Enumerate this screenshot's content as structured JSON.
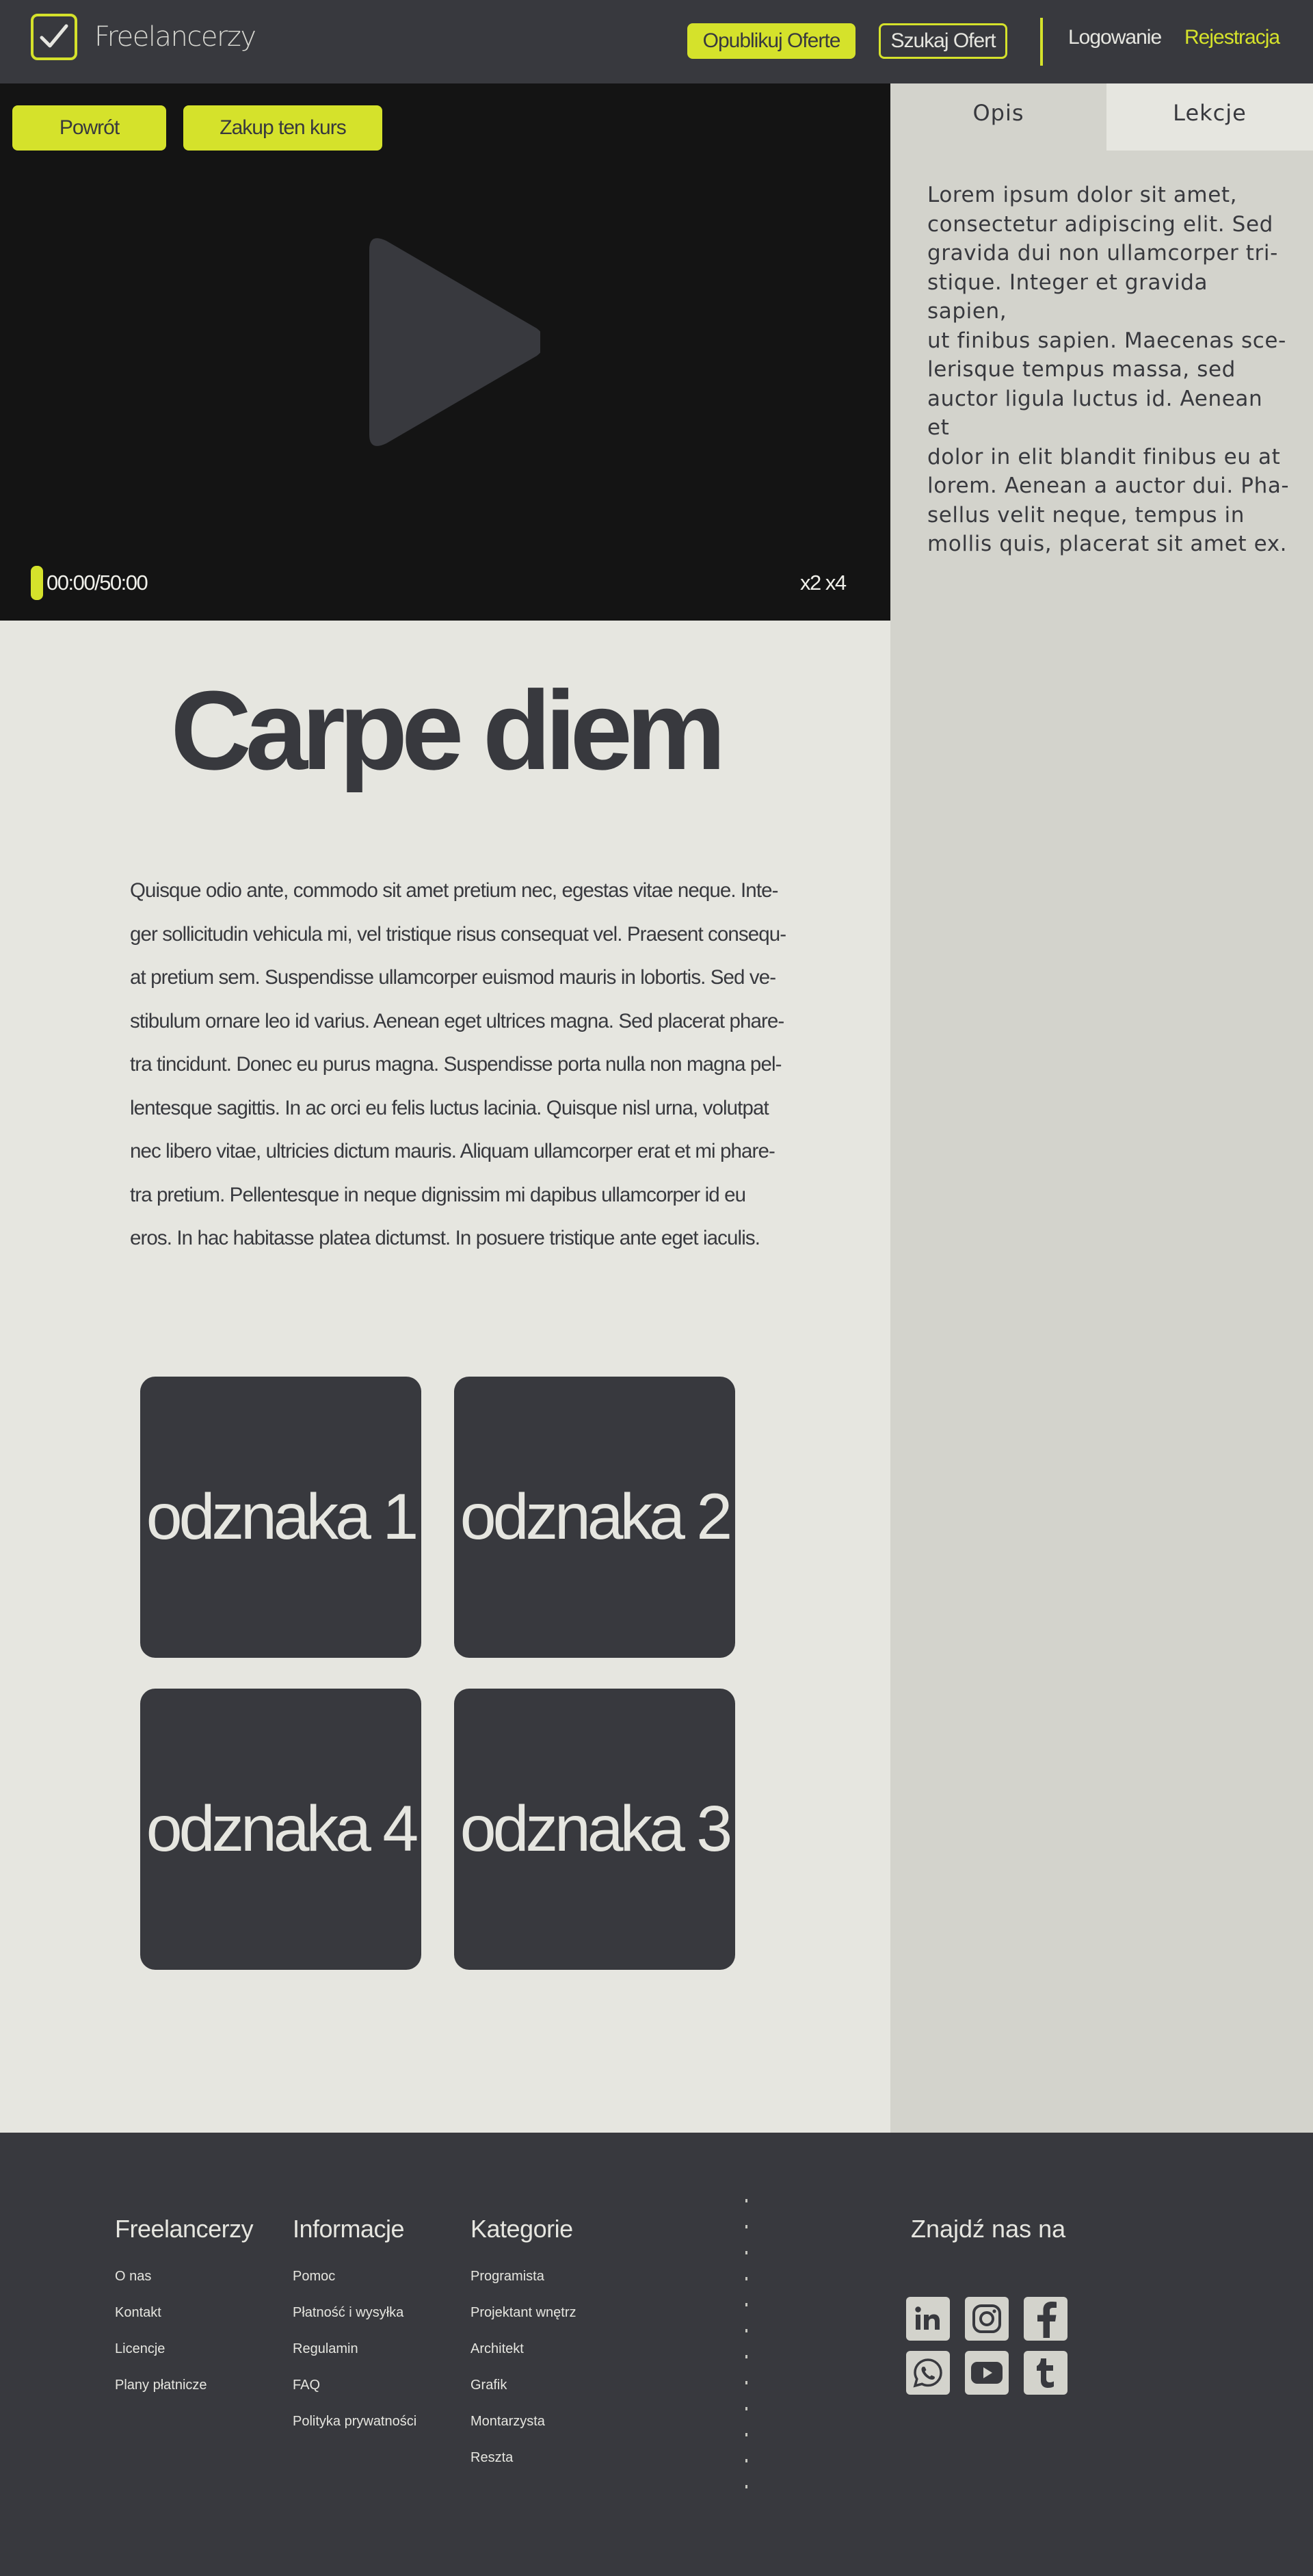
{
  "navbar": {
    "brand": "Freelancerzy",
    "publish_label": "Opublikuj Oferte",
    "search_label": "Szukaj Ofert",
    "login_label": "Logowanie",
    "register_label": "Rejestracja"
  },
  "video": {
    "back_label": "Powrót",
    "buy_label": "Zakup ten kurs",
    "time": "00:00/50:00",
    "speed": "x2 x4",
    "progress": 0
  },
  "sidebar": {
    "tabs": [
      {
        "label": "Opis",
        "active": true
      },
      {
        "label": "Lekcje",
        "active": false
      }
    ],
    "description": " Lorem ipsum dolor sit amet,\nconsectetur adipiscing elit. Sed\ngravida dui non ullamcorper tri-\nstique. Integer et gravida sapien,\nut finibus sapien. Maecenas sce-\nlerisque tempus massa, sed\nauctor ligula luctus id. Aenean et\ndolor in elit blandit finibus eu at\nlorem. Aenean a auctor dui. Pha-\nsellus velit neque, tempus in\nmollis quis, placerat sit amet ex."
  },
  "main": {
    "title": "Carpe diem",
    "body": "Quisque odio ante, commodo sit amet pretium nec, egestas vitae neque. Inte-\nger sollicitudin vehicula mi, vel tristique risus consequat vel. Praesent consequ-\nat pretium sem. Suspendisse ullamcorper euismod mauris in lobortis. Sed ve-\nstibulum ornare leo id varius. Aenean eget ultrices magna. Sed placerat phare-\ntra tincidunt. Donec eu purus magna. Suspendisse porta nulla non magna pel-\nlentesque sagittis. In ac orci eu felis luctus lacinia. Quisque nisl urna, volutpat\nnec libero vitae, ultricies dictum mauris. Aliquam ullamcorper erat et mi phare-\ntra pretium. Pellentesque in neque dignissim mi dapibus ullamcorper id eu\neros. In hac habitasse platea dictumst. In posuere tristique ante eget iaculis.",
    "badges": [
      "odznaka 1",
      "odznaka 2",
      "odznaka 4",
      "odznaka 3"
    ]
  },
  "footer": {
    "col1": {
      "title": "Freelancerzy",
      "links": [
        "O nas",
        "Kontakt",
        "Licencje",
        "Plany płatnicze"
      ]
    },
    "col2": {
      "title": "Informacje",
      "links": [
        "Pomoc",
        "Płatność i wysyłka",
        "Regulamin",
        "FAQ",
        "Polityka prywatności"
      ]
    },
    "col3": {
      "title": "Kategorie",
      "links": [
        "Programista",
        "Projektant wnętrz",
        "Architekt",
        "Grafik",
        "Montarzysta",
        "Reszta"
      ]
    },
    "find_us": "Znajdź nas na",
    "socials": [
      "linkedin-icon",
      "instagram-icon",
      "facebook-icon",
      "whatsapp-icon",
      "youtube-icon",
      "tumblr-icon"
    ]
  },
  "colors": {
    "accent": "#d5e22b",
    "dark": "#38393e",
    "light": "#e6e6e0",
    "sidebar": "#d3d3cc",
    "video_bg": "#141414"
  }
}
